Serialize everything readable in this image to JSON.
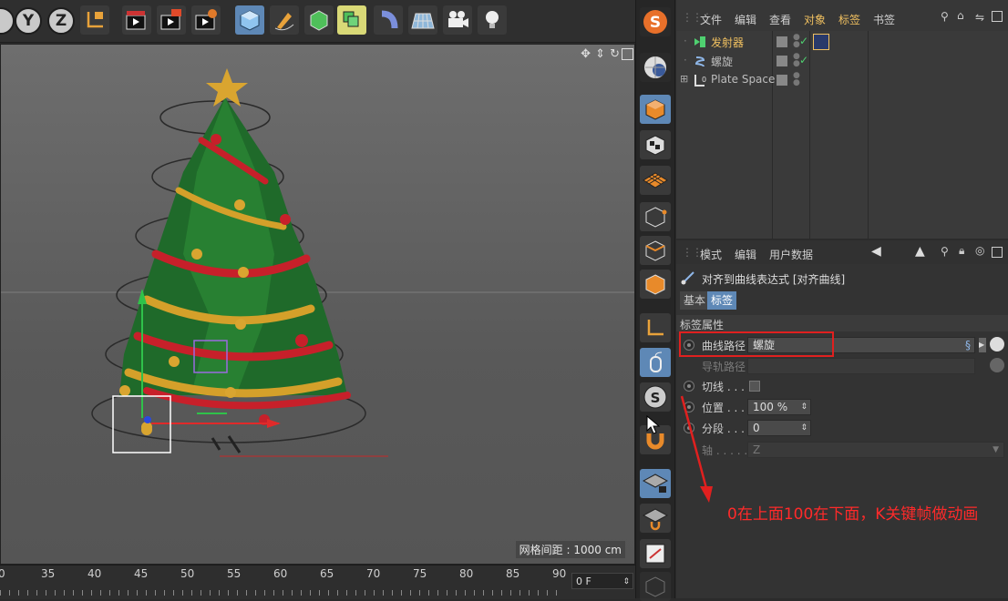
{
  "toolbar": {
    "axis_y": "Y",
    "axis_z": "Z"
  },
  "viewport": {
    "grid_spacing": "网格间距 : 1000 cm"
  },
  "timeline": {
    "ticks": [
      "0",
      "35",
      "40",
      "45",
      "50",
      "55",
      "60",
      "65",
      "70",
      "75",
      "80",
      "85",
      "90"
    ],
    "current_frame": "0 F"
  },
  "object_manager": {
    "menu": [
      "文件",
      "编辑",
      "查看",
      "对象",
      "标签",
      "书签"
    ],
    "objects": [
      {
        "name": "发射器",
        "icon": "emitter-icon"
      },
      {
        "name": "螺旋",
        "icon": "helix-icon"
      },
      {
        "name": "Plate Space",
        "icon": "null-icon"
      }
    ]
  },
  "attribute_manager": {
    "menu": [
      "模式",
      "编辑",
      "用户数据"
    ],
    "title": "对齐到曲线表达式 [对齐曲线]",
    "tabs": [
      "基本",
      "标签"
    ],
    "section": "标签属性",
    "props": {
      "curve_path_label": "曲线路径",
      "curve_path_value": "螺旋",
      "rail_path_label": "导轨路径",
      "tangent_label": "切线 . . . . .",
      "position_label": "位置 . . . .",
      "position_value": "100 %",
      "segment_label": "分段 . . . .",
      "segment_value": "0",
      "axis_label": "轴 . . . . . .",
      "axis_value": "Z"
    }
  },
  "annotation": "0在上面100在下面，K关键帧做动画",
  "colors": {
    "highlight": "#5e88b6",
    "annotation_red": "#ff2a2a",
    "menu_active": "#f0c060"
  }
}
